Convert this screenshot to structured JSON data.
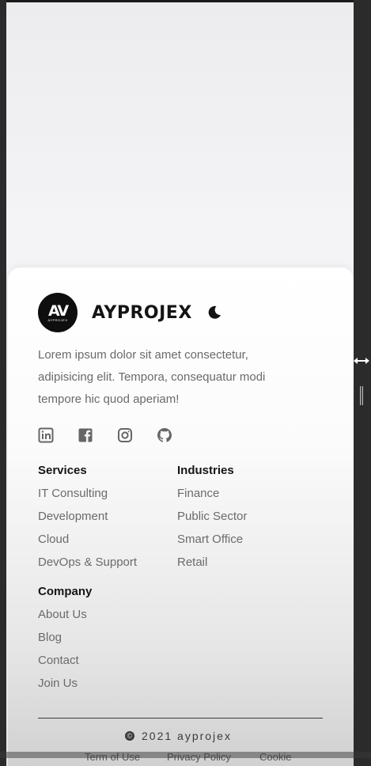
{
  "brand": {
    "logo_text": "AV",
    "logo_subtext": "AYPROJEX",
    "name": "AYPROJEX"
  },
  "description": "Lorem ipsum dolor sit amet consectetur, adipisicing elit. Tempora, consequatur modi tempore hic quod aperiam!",
  "socials": [
    "linkedin-icon",
    "facebook-icon",
    "instagram-icon",
    "github-icon"
  ],
  "services": {
    "title": "Services",
    "items": [
      "IT Consulting",
      "Development",
      "Cloud",
      "DevOps & Support"
    ]
  },
  "industries": {
    "title": "Industries",
    "items": [
      "Finance",
      "Public Sector",
      "Smart Office",
      "Retail"
    ]
  },
  "company": {
    "title": "Company",
    "items": [
      "About Us",
      "Blog",
      "Contact",
      "Join Us"
    ]
  },
  "footer": {
    "copyright": "2021 ayprojex",
    "links": [
      "Term of Use",
      "Privacy Policy",
      "Cookie"
    ]
  },
  "colors": {
    "text_dark": "#141414",
    "text_muted": "#6b6b6b",
    "background": "#2b2b2b"
  }
}
